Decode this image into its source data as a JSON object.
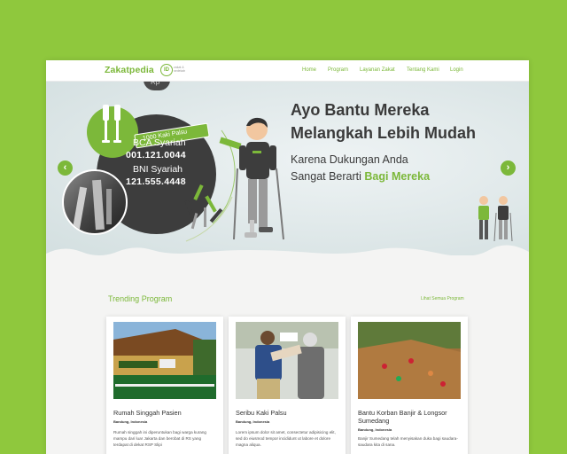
{
  "brand": {
    "name": "Zakatpedia",
    "mark": "ID",
    "tagline": "zakat & sedekah"
  },
  "nav": [
    "Home",
    "Program",
    "Layanan Zakat",
    "Tentang Kami",
    "Login"
  ],
  "hero": {
    "ribbon": "1000 Kaki Palsu",
    "banks": [
      {
        "name": "BCA Syariah",
        "number": "001.121.0044"
      },
      {
        "name": "BNI Syariah",
        "number": "121.555.4448"
      }
    ],
    "rp_badge": "Rp",
    "headline_line1": "Ayo Bantu Mereka",
    "headline_line2": "Melangkah Lebih Mudah",
    "sub_line1": "Karena Dukungan Anda",
    "sub_line2_prefix": "Sangat Berarti ",
    "sub_line2_highlight": "Bagi Mereka",
    "prev_icon": "chevron-left-icon",
    "next_icon": "chevron-right-icon"
  },
  "trending": {
    "title": "Trending Program",
    "see_all": "Lihat Semua Program",
    "cards": [
      {
        "title": "Rumah Singgah Pasien",
        "location": "Bandung, Indonesia",
        "desc": "Rumah singgah ini diperuntukan bagi warga kurang mampu dari luar Jakarta dan berobat di RS yang terdapat di dekat RSP Slipi"
      },
      {
        "title": "Seribu Kaki Palsu",
        "location": "Bandung, Indonesia",
        "desc": "Lorem ipsum dolor sit amet, consectetur adipisicing elit, sed do eiusmod tempor incididunt ut labore et dolore magna aliqua."
      },
      {
        "title": "Bantu Korban Banjir & Longsor Sumedang",
        "location": "Bandung, Indonesia",
        "desc": "Banjir Sumedang telah menyisakan duka bagi saudara-saudara kita di sana."
      }
    ]
  },
  "colors": {
    "background": "#8fc83d",
    "accent": "#7cb83a",
    "dark": "#3d3d3d"
  }
}
